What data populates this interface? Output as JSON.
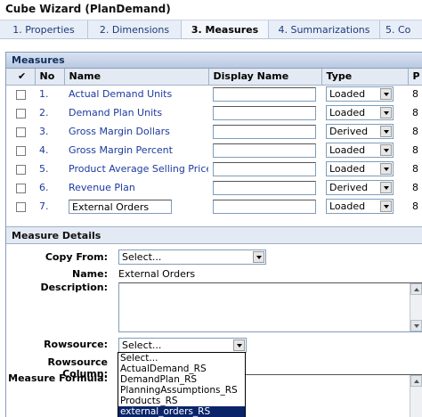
{
  "window": {
    "title": "Cube Wizard (PlanDemand)"
  },
  "tabs": [
    {
      "label": "1. Properties",
      "active": false
    },
    {
      "label": "2. Dimensions",
      "active": false
    },
    {
      "label": "3. Measures",
      "active": true
    },
    {
      "label": "4. Summarizations",
      "active": false
    },
    {
      "label": "5. Co",
      "active": false
    }
  ],
  "measures": {
    "header": "Measures",
    "columns": {
      "check": "✔",
      "no": "No",
      "name": "Name",
      "display_name": "Display Name",
      "type": "Type",
      "extra": "P"
    },
    "rows": [
      {
        "no": "1.",
        "name": "Actual Demand Units",
        "display_name": "",
        "type": "Loaded",
        "extra": "8"
      },
      {
        "no": "2.",
        "name": "Demand Plan Units",
        "display_name": "",
        "type": "Loaded",
        "extra": "8"
      },
      {
        "no": "3.",
        "name": "Gross Margin Dollars",
        "display_name": "",
        "type": "Derived",
        "extra": "8"
      },
      {
        "no": "4.",
        "name": "Gross Margin Percent",
        "display_name": "",
        "type": "Loaded",
        "extra": "8"
      },
      {
        "no": "5.",
        "name": "Product Average Selling Price",
        "display_name": "",
        "type": "Loaded",
        "extra": "8"
      },
      {
        "no": "6.",
        "name": "Revenue Plan",
        "display_name": "",
        "type": "Derived",
        "extra": "8"
      },
      {
        "no": "7.",
        "name": "External Orders",
        "display_name": "",
        "type": "Loaded",
        "extra": "8",
        "editable": true
      }
    ]
  },
  "details": {
    "header": "Measure Details",
    "copy_from_label": "Copy From:",
    "copy_from_value": "Select...",
    "name_label": "Name:",
    "name_value": "External Orders",
    "description_label": "Description:",
    "rowsource_label": "Rowsource:",
    "rowsource_value": "Select...",
    "rowsource_column_label": "Rowsource Column:",
    "measure_formula_label": "Measure Formula:",
    "rowsource_options": [
      "Select...",
      "ActualDemand_RS",
      "DemandPlan_RS",
      "PlanningAssumptions_RS",
      "Products_RS",
      "external_orders_RS"
    ],
    "rowsource_highlighted": "external_orders_RS"
  }
}
